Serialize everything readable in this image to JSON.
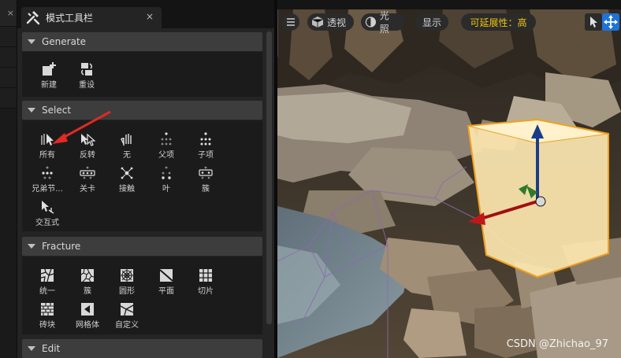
{
  "left_strip": {
    "glyph": "×"
  },
  "tab": {
    "title": "模式工具栏",
    "close": "×",
    "icon": "hammer-icon"
  },
  "sections": {
    "generate": {
      "title": "Generate",
      "tools": [
        {
          "label": "新建",
          "icon": "new-icon"
        },
        {
          "label": "重设",
          "icon": "reset-icon"
        }
      ]
    },
    "select": {
      "title": "Select",
      "tools": [
        {
          "label": "所有",
          "icon": "select-all-icon"
        },
        {
          "label": "反转",
          "icon": "invert-icon"
        },
        {
          "label": "无",
          "icon": "none-icon"
        },
        {
          "label": "父项",
          "icon": "parent-icon"
        },
        {
          "label": "子项",
          "icon": "children-icon"
        },
        {
          "label": "兄弟节...",
          "icon": "siblings-icon"
        },
        {
          "label": "关卡",
          "icon": "level-icon"
        },
        {
          "label": "接触",
          "icon": "contact-icon"
        },
        {
          "label": "叶",
          "icon": "leaf-icon"
        },
        {
          "label": "簇",
          "icon": "cluster-icon"
        },
        {
          "label": "交互式",
          "icon": "interactive-icon"
        }
      ]
    },
    "fracture": {
      "title": "Fracture",
      "tools": [
        {
          "label": "统一",
          "icon": "uniform-icon"
        },
        {
          "label": "簇",
          "icon": "cluster-fracture-icon"
        },
        {
          "label": "圆形",
          "icon": "radial-icon"
        },
        {
          "label": "平面",
          "icon": "plane-icon"
        },
        {
          "label": "切片",
          "icon": "slice-icon"
        },
        {
          "label": "砖块",
          "icon": "brick-icon"
        },
        {
          "label": "网格体",
          "icon": "mesh-icon"
        },
        {
          "label": "自定义",
          "icon": "custom-icon"
        }
      ]
    },
    "edit": {
      "title": "Edit"
    }
  },
  "viewport": {
    "toolbar": {
      "menu_icon": "hamburger-icon",
      "perspective": "透视",
      "lighting": "光照",
      "show": "显示",
      "scalability": "可延展性：高"
    },
    "watermark": "CSDN @Zhichao_97",
    "accent": "#1e73d8",
    "scalability_color": "#f1c40f"
  }
}
